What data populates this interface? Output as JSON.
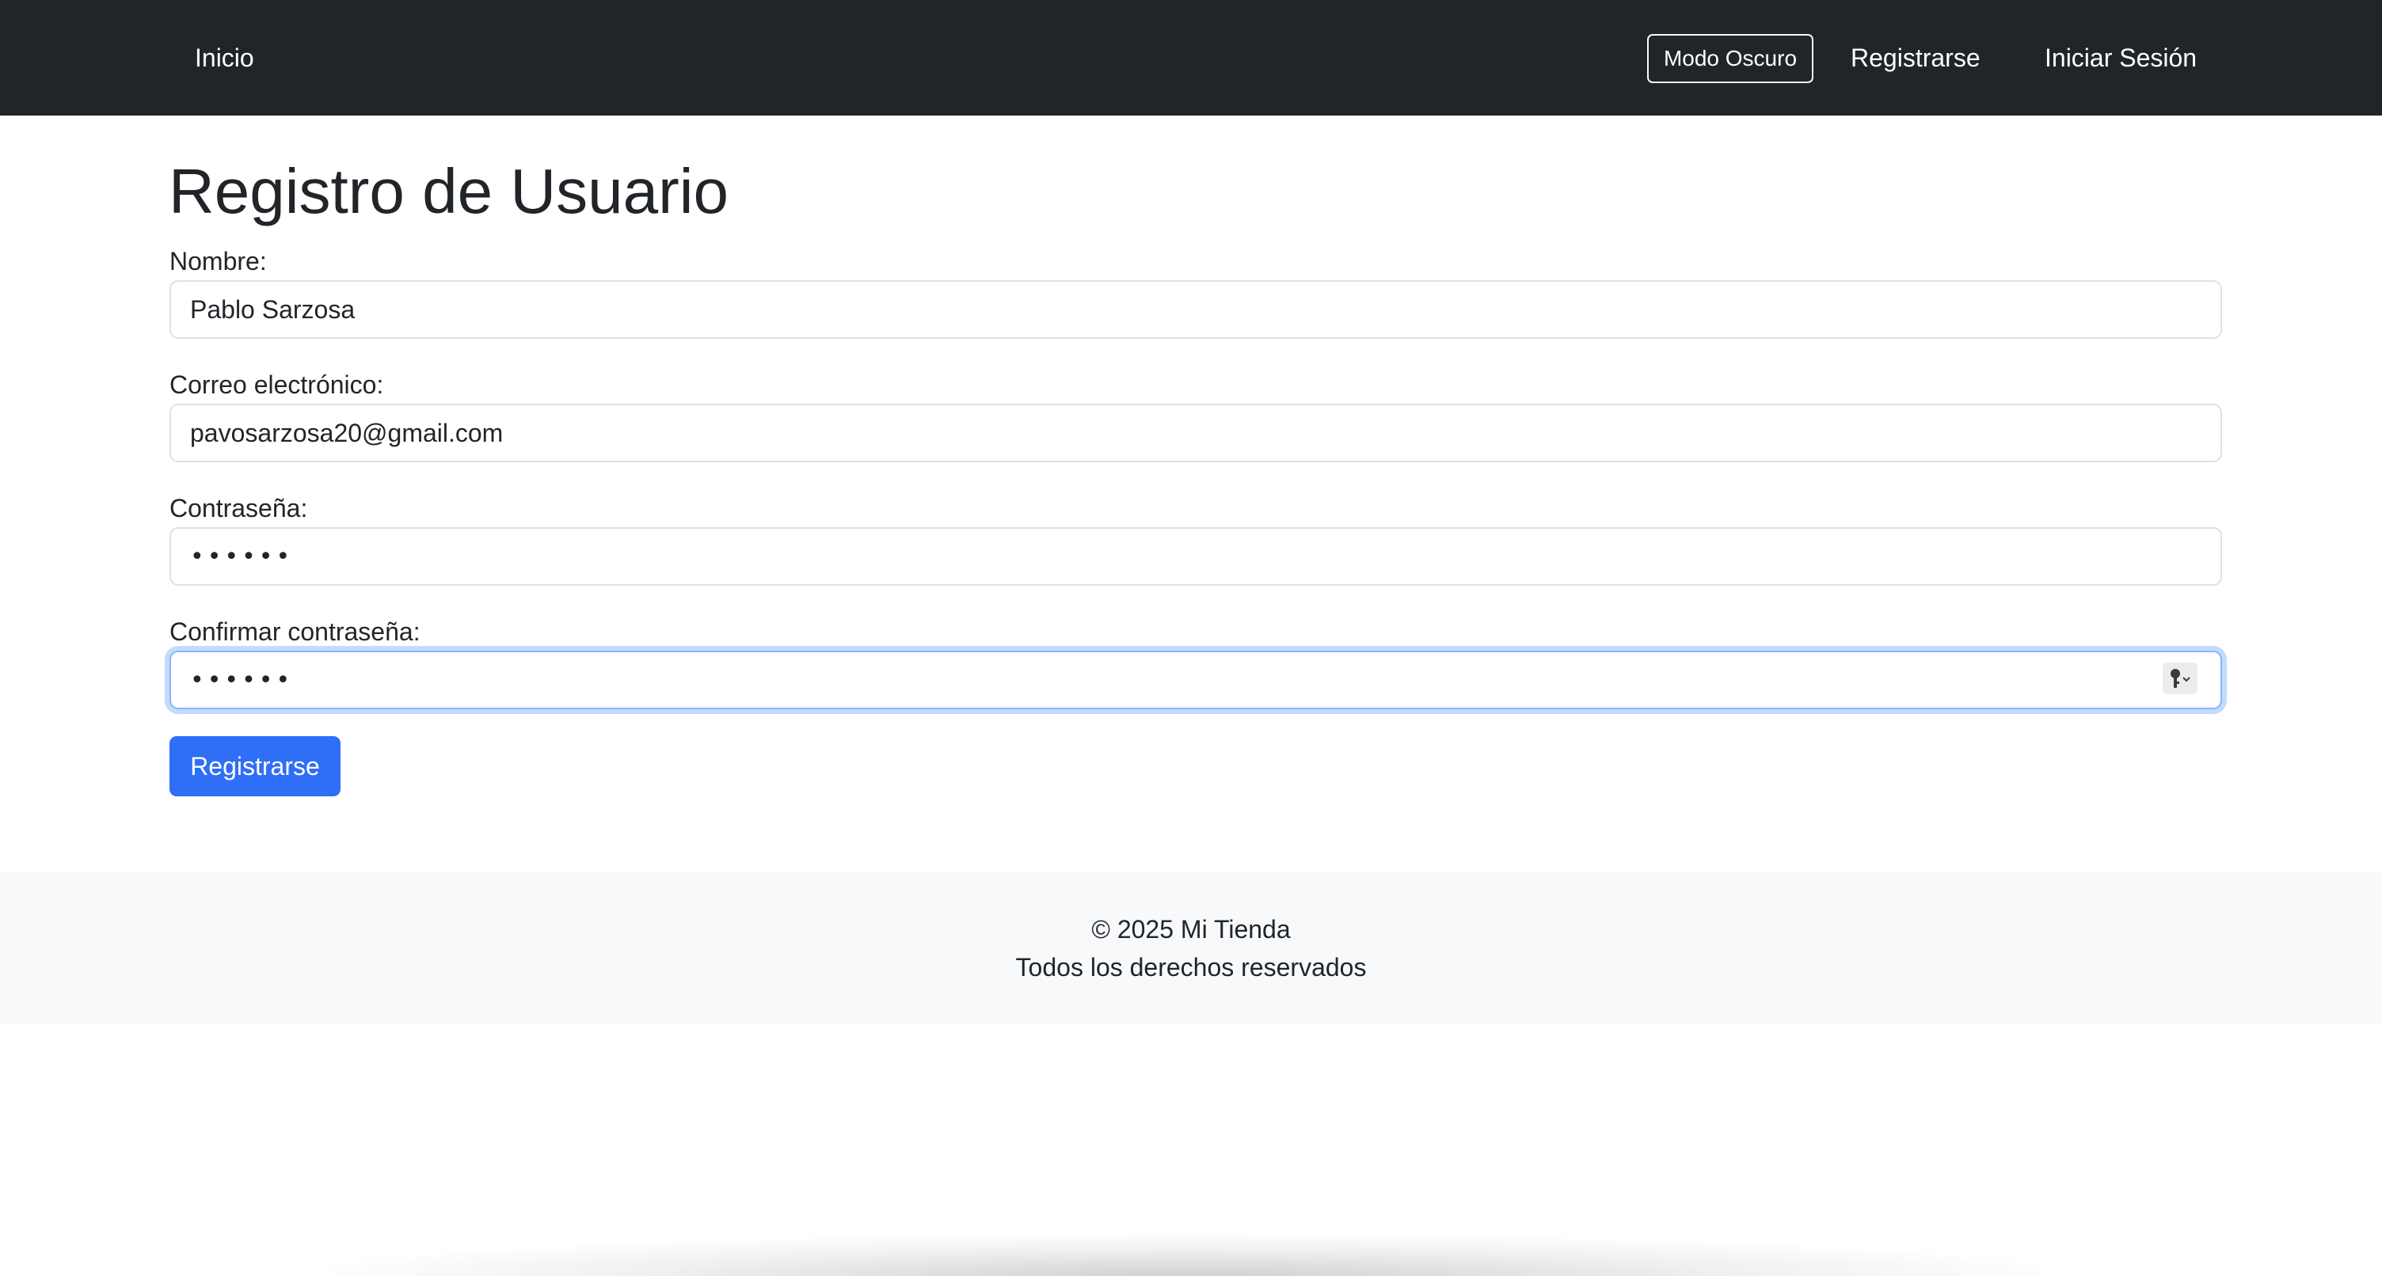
{
  "navbar": {
    "home_label": "Inicio",
    "dark_mode_label": "Modo Oscuro",
    "register_label": "Registrarse",
    "login_label": "Iniciar Sesión"
  },
  "page": {
    "title": "Registro de Usuario"
  },
  "form": {
    "name_label": "Nombre:",
    "name_value": "Pablo Sarzosa",
    "email_label": "Correo electrónico:",
    "email_value": "pavosarzosa20@gmail.com",
    "password_label": "Contraseña:",
    "password_value": "••••••",
    "confirm_label": "Confirmar contraseña:",
    "confirm_value": "••••••",
    "submit_label": "Registrarse"
  },
  "footer": {
    "copyright": "© 2025 Mi Tienda",
    "rights": "Todos los derechos reservados"
  },
  "icons": {
    "password_manager": "key-icon"
  },
  "colors": {
    "navbar_bg": "#212529",
    "primary": "#2f6ef7",
    "focus_border": "#86b7fe",
    "footer_bg": "#f8f9fa"
  }
}
